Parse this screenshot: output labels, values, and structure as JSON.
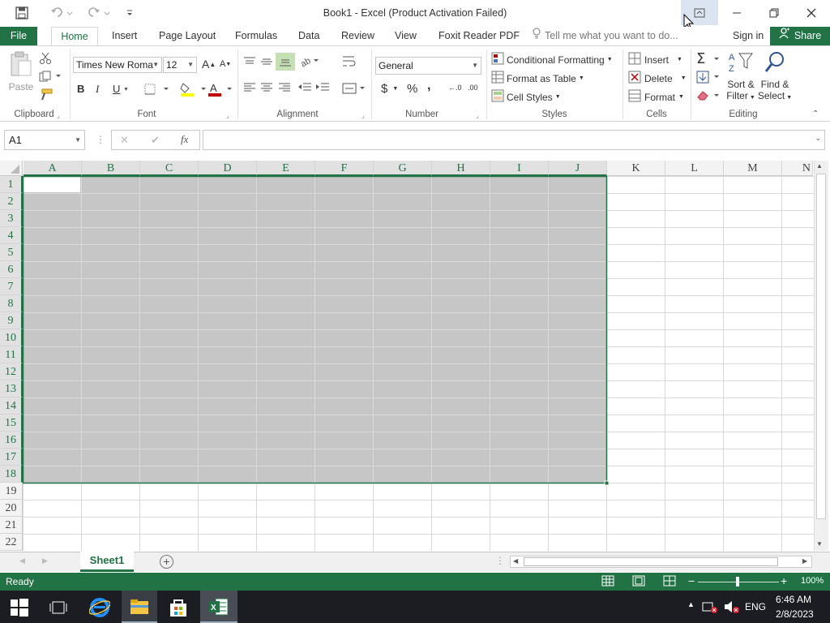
{
  "app": {
    "title": "Book1 - Excel (Product Activation Failed)"
  },
  "quick_access": {
    "save_icon": "save-icon",
    "undo_icon": "undo-icon",
    "redo_icon": "redo-icon",
    "customize_icon": "customize-icon"
  },
  "menu": {
    "tabs": [
      "File",
      "Home",
      "Insert",
      "Page Layout",
      "Formulas",
      "Data",
      "Review",
      "View",
      "Foxit Reader PDF"
    ],
    "tell_me": "Tell me what you want to do...",
    "sign_in": "Sign in",
    "share": "Share"
  },
  "ribbon": {
    "clipboard": {
      "paste": "Paste",
      "label": "Clipboard"
    },
    "font": {
      "name": "Times New Roma",
      "size": "12",
      "bold": "B",
      "italic": "I",
      "underline": "U",
      "label": "Font",
      "grow": "A",
      "shrink": "A",
      "color_letter": "A"
    },
    "alignment": {
      "label": "Alignment"
    },
    "number": {
      "format": "General",
      "currency": "$",
      "percent": "%",
      "comma": ",",
      "inc_dec": "←.0",
      "dec_dec": ".00",
      "label": "Number"
    },
    "styles": {
      "conditional": "Conditional Formatting",
      "table": "Format as Table",
      "cell_styles": "Cell Styles",
      "label": "Styles"
    },
    "cells": {
      "insert": "Insert",
      "delete": "Delete",
      "format": "Format",
      "label": "Cells"
    },
    "editing": {
      "sort": "Sort &",
      "filter": "Filter",
      "find": "Find &",
      "select": "Select",
      "label": "Editing"
    }
  },
  "formula_bar": {
    "name_box": "A1",
    "cancel": "✕",
    "enter": "✔",
    "fx": "fx",
    "value": ""
  },
  "grid": {
    "columns": [
      "A",
      "B",
      "C",
      "D",
      "E",
      "F",
      "G",
      "H",
      "I",
      "J",
      "K",
      "L",
      "M",
      "N"
    ],
    "rows": [
      "1",
      "2",
      "3",
      "4",
      "5",
      "6",
      "7",
      "8",
      "9",
      "10",
      "11",
      "12",
      "13",
      "14",
      "15",
      "16",
      "17",
      "18",
      "19",
      "20",
      "21",
      "22"
    ],
    "selection": "A1:J18",
    "active_cell": "A1"
  },
  "sheets": {
    "tabs": [
      "Sheet1"
    ],
    "active": "Sheet1"
  },
  "status": {
    "text": "Ready",
    "zoom": "100%"
  },
  "taskbar": {
    "time": "6:46 AM",
    "date": "2/8/2023",
    "lang": "ENG"
  },
  "colors": {
    "accent": "#217346",
    "selection_fill": "#c6c6c6",
    "taskbar": "#1b1d22"
  }
}
